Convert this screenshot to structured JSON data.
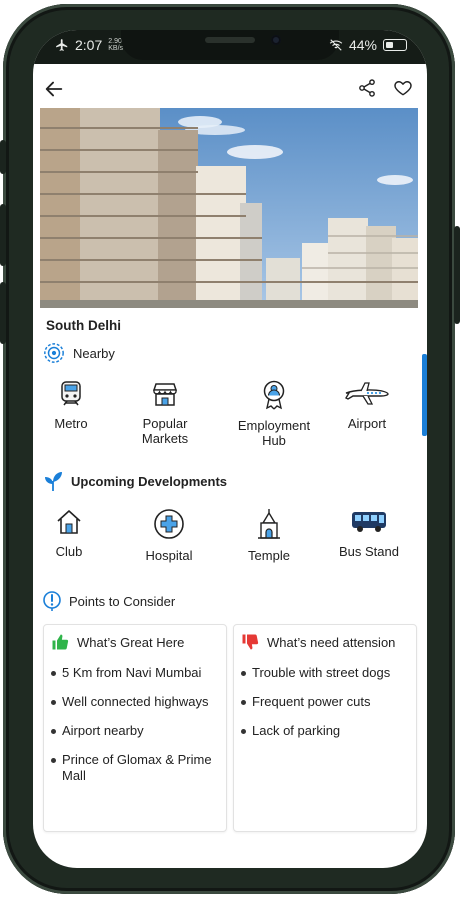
{
  "status": {
    "time": "2:07",
    "speed": "2.90",
    "speed_unit": "KB/s",
    "battery": "44%",
    "battery_level": 0.44
  },
  "header": {
    "back_icon": "arrow-left-icon",
    "share_icon": "share-icon",
    "favorite_icon": "heart-icon"
  },
  "location": {
    "title": "South Delhi"
  },
  "nearby": {
    "heading": "Nearby",
    "items": [
      {
        "label": "Metro",
        "icon": "metro-train-icon"
      },
      {
        "label": "Popular Markets",
        "icon": "market-store-icon"
      },
      {
        "label": "Employment Hub",
        "icon": "employment-badge-icon"
      },
      {
        "label": "Airport",
        "icon": "airplane-icon"
      }
    ]
  },
  "upcoming": {
    "heading": "Upcoming Developments",
    "items": [
      {
        "label": "Club",
        "icon": "house-icon"
      },
      {
        "label": "Hospital",
        "icon": "hospital-cross-icon"
      },
      {
        "label": "Temple",
        "icon": "temple-icon"
      },
      {
        "label": "Bus Stand",
        "icon": "bus-icon"
      }
    ]
  },
  "points": {
    "heading": "Points to Consider",
    "great": {
      "title": "What’s Great Here",
      "items": [
        "5 Km from Navi Mumbai",
        "Well connected highways",
        "Airport nearby",
        "Prince of Glomax & Prime Mall"
      ]
    },
    "attention": {
      "title": "What’s need attension",
      "items": [
        "Trouble with street dogs",
        "Frequent power cuts",
        "Lack of parking"
      ]
    }
  },
  "colors": {
    "accent": "#1a7fd8",
    "positive": "#2fb44a",
    "negative": "#e53935",
    "frame": "#1f2a22"
  }
}
